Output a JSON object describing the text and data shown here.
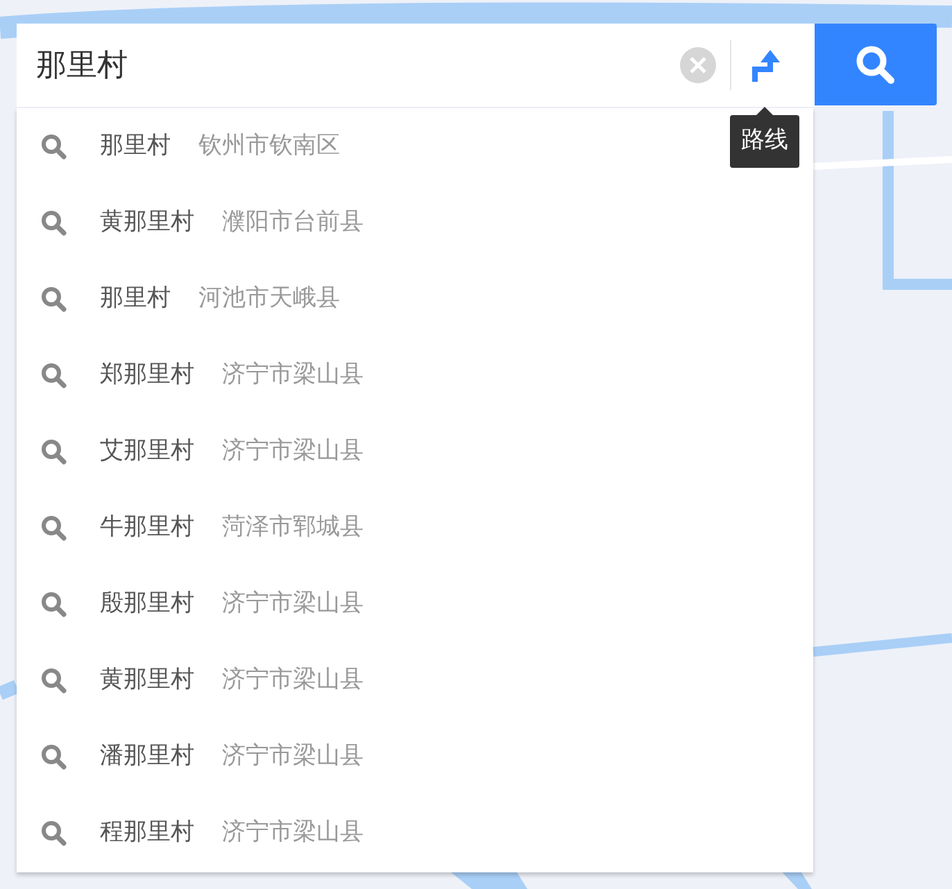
{
  "search": {
    "value": "那里村"
  },
  "route_tooltip": "路线",
  "suggestions": [
    {
      "name": "那里村",
      "region": "钦州市钦南区"
    },
    {
      "name": "黄那里村",
      "region": "濮阳市台前县"
    },
    {
      "name": "那里村",
      "region": "河池市天峨县"
    },
    {
      "name": "郑那里村",
      "region": "济宁市梁山县"
    },
    {
      "name": "艾那里村",
      "region": "济宁市梁山县"
    },
    {
      "name": "牛那里村",
      "region": "菏泽市郓城县"
    },
    {
      "name": "殷那里村",
      "region": "济宁市梁山县"
    },
    {
      "name": "黄那里村",
      "region": "济宁市梁山县"
    },
    {
      "name": "潘那里村",
      "region": "济宁市梁山县"
    },
    {
      "name": "程那里村",
      "region": "济宁市梁山县"
    }
  ]
}
